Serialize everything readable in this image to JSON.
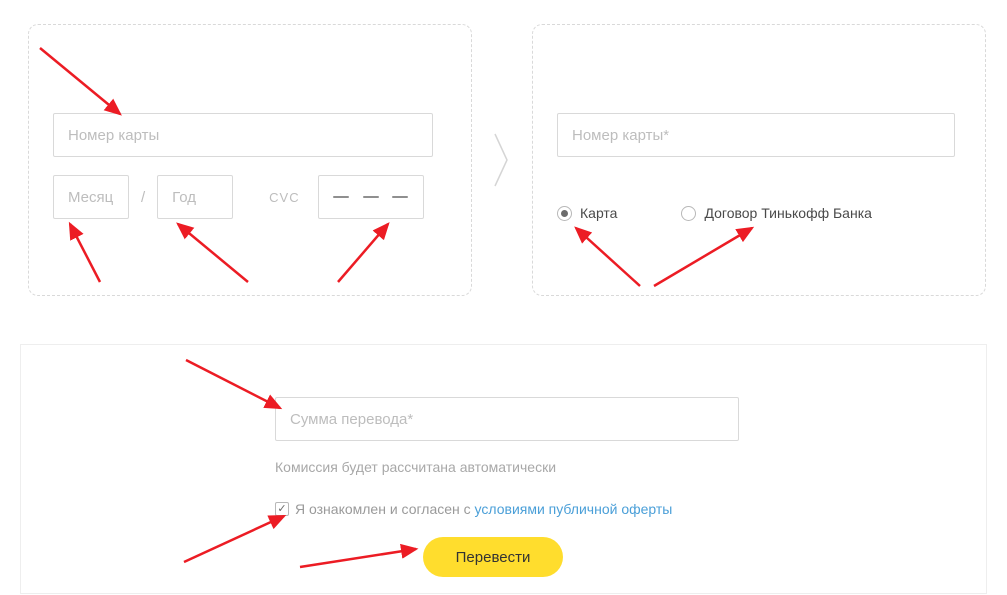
{
  "from_card": {
    "number_placeholder": "Номер карты",
    "month_placeholder": "Месяц",
    "year_placeholder": "Год",
    "cvc_label": "CVC"
  },
  "to_card": {
    "number_placeholder": "Номер карты*",
    "radio_card_label": "Карта",
    "radio_contract_label": "Договор Тинькофф Банка"
  },
  "transfer": {
    "amount_placeholder": "Сумма перевода*",
    "commission_note": "Комиссия будет рассчитана автоматически",
    "agree_prefix": "Я ознакомлен и согласен с ",
    "agree_link": "условиями публичной оферты",
    "button_label": "Перевести"
  }
}
